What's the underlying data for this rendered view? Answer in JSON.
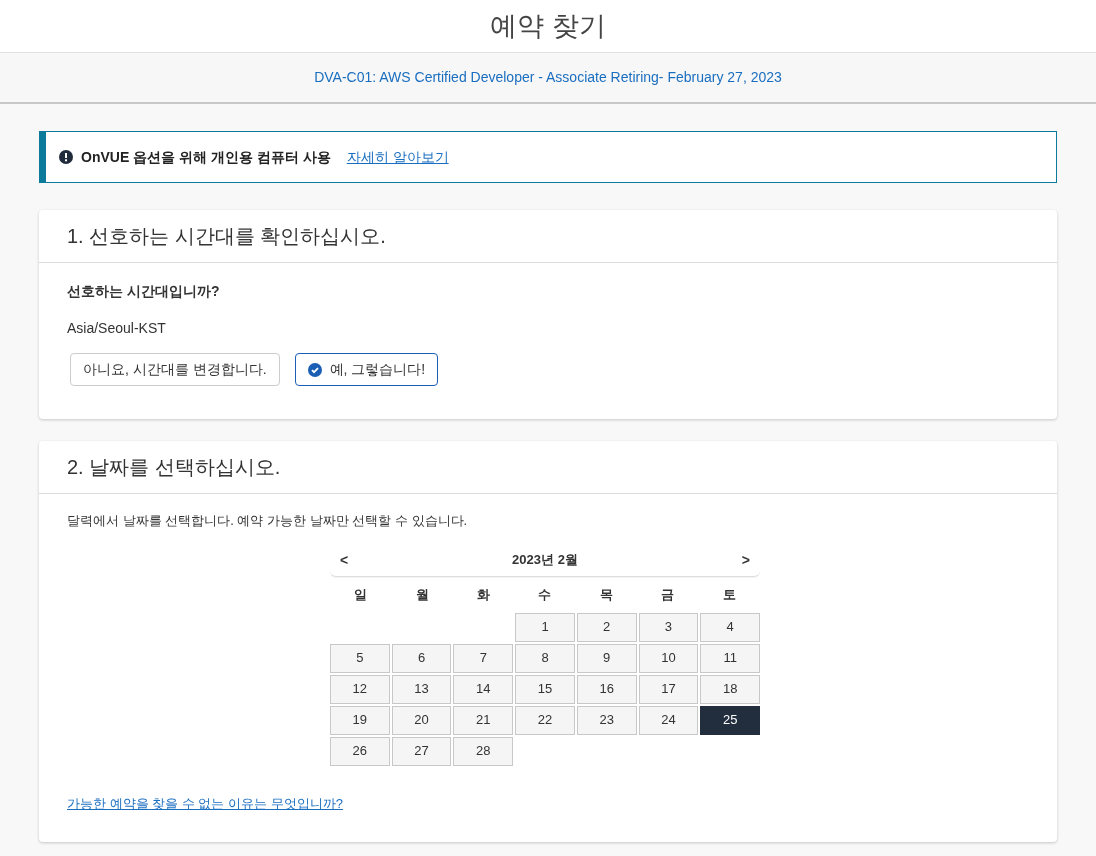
{
  "page_title": "예약 찾기",
  "exam_link": "DVA-C01: AWS Certified Developer - Associate Retiring- February 27, 2023",
  "alert": {
    "message": "OnVUE 옵션을 위해 개인용 컴퓨터 사용",
    "link": "자세히 알아보기"
  },
  "timezone_section": {
    "title": "1. 선호하는 시간대를 확인하십시오.",
    "question": "선호하는 시간대입니까?",
    "timezone": "Asia/Seoul-KST",
    "buttons": [
      {
        "label": "아니요, 시간대를 변경합니다.",
        "selected": false
      },
      {
        "label": "예, 그렇습니다!",
        "selected": true
      }
    ]
  },
  "date_section": {
    "title": "2. 날짜를 선택하십시오.",
    "instruction": "달력에서 날짜를 선택합니다. 예약 가능한 날짜만 선택할 수 있습니다.",
    "calendar": {
      "prev": "<",
      "month": "2023년 2월",
      "next": ">",
      "weekdays": [
        "일",
        "월",
        "화",
        "수",
        "목",
        "금",
        "토"
      ],
      "weeks": [
        [
          {
            "kind": "blank"
          },
          {
            "kind": "blank"
          },
          {
            "kind": "blank"
          },
          {
            "day": "1",
            "selected": false
          },
          {
            "day": "2",
            "selected": false
          },
          {
            "day": "3",
            "selected": false
          },
          {
            "day": "4",
            "selected": false
          }
        ],
        [
          {
            "day": "5",
            "selected": false
          },
          {
            "day": "6",
            "selected": false
          },
          {
            "day": "7",
            "selected": false
          },
          {
            "day": "8",
            "selected": false
          },
          {
            "day": "9",
            "selected": false
          },
          {
            "day": "10",
            "selected": false
          },
          {
            "day": "11",
            "selected": false
          }
        ],
        [
          {
            "day": "12",
            "selected": false
          },
          {
            "day": "13",
            "selected": false
          },
          {
            "day": "14",
            "selected": false
          },
          {
            "day": "15",
            "selected": false
          },
          {
            "day": "16",
            "selected": false
          },
          {
            "day": "17",
            "selected": false
          },
          {
            "day": "18",
            "selected": false
          }
        ],
        [
          {
            "day": "19",
            "selected": false
          },
          {
            "day": "20",
            "selected": false
          },
          {
            "day": "21",
            "selected": false
          },
          {
            "day": "22",
            "selected": false
          },
          {
            "day": "23",
            "selected": false
          },
          {
            "day": "24",
            "selected": false
          },
          {
            "day": "25",
            "selected": true
          }
        ],
        [
          {
            "day": "26",
            "selected": false
          },
          {
            "day": "27",
            "selected": false
          },
          {
            "day": "28",
            "selected": false
          },
          {
            "kind": "blank"
          },
          {
            "kind": "blank"
          },
          {
            "kind": "blank"
          },
          {
            "kind": "blank"
          }
        ]
      ]
    },
    "help_link": "가능한 예약을 찾을 수 없는 이유는 무엇입니까?"
  }
}
